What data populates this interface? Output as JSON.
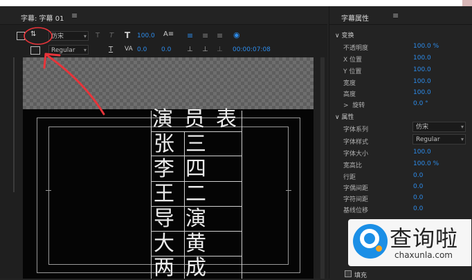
{
  "left_panel": {
    "title": "字幕: 字幕 01",
    "menu_glyph": "≡"
  },
  "toolbar": {
    "font_family": "仿宋",
    "font_style": "Regular",
    "font_size": "100.0",
    "leading": "0.0",
    "kerning": "0.0",
    "baseline": "0.0",
    "timecode": "00:00:07:08"
  },
  "canvas": {
    "header_row": [
      "演",
      "员",
      "表"
    ],
    "rows": [
      [
        "张",
        "三"
      ],
      [
        "李",
        "四"
      ],
      [
        "王",
        "二"
      ],
      [
        "导",
        "演"
      ],
      [
        "大",
        "黄"
      ],
      [
        "两",
        "成"
      ]
    ]
  },
  "right_panel": {
    "title": "字幕属性",
    "menu_glyph": "≡",
    "transform": {
      "label": "变换",
      "opacity_label": "不透明度",
      "opacity": "100.0 %",
      "x_label": "X 位置",
      "x": "100.0",
      "y_label": "Y 位置",
      "y": "100.0",
      "width_label": "宽度",
      "width": "100.0",
      "height_label": "高度",
      "height": "100.0",
      "rotation_label": "旋转",
      "rotation": "0.0 °"
    },
    "properties": {
      "label": "属性",
      "font_family_label": "字体系列",
      "font_family": "仿宋",
      "font_style_label": "字体样式",
      "font_style": "Regular",
      "font_size_label": "字体大小",
      "font_size": "100.0",
      "aspect_label": "宽高比",
      "aspect": "100.0 %",
      "leading_label": "行距",
      "leading": "0.0",
      "kerning_label": "字偶间距",
      "kerning": "0.0",
      "tracking_label": "字符间距",
      "tracking": "0.0",
      "baseline_label": "基线位移",
      "baseline": "0.0"
    },
    "fill_label": "填充"
  },
  "watermark": {
    "chinese": "查询啦",
    "url": "chaxunla.com"
  },
  "colors": {
    "accent": "#2d8ceb",
    "annotation": "#e8343a",
    "watermark_blue": "#1b8fe6"
  }
}
